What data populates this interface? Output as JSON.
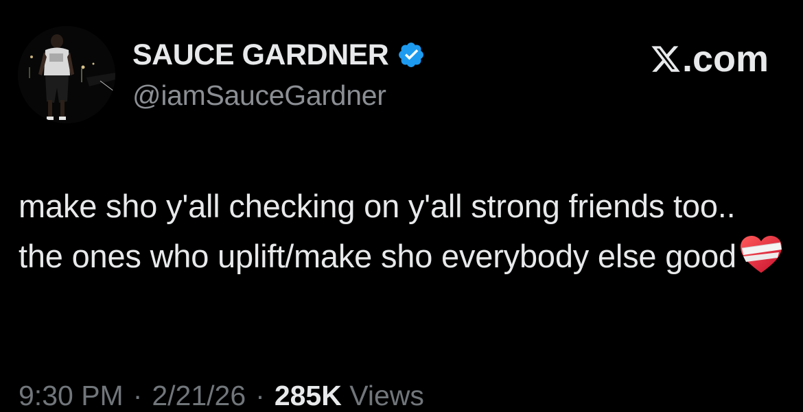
{
  "author": {
    "display_name": "SAUCE GARDNER",
    "handle": "@iamSauceGardner",
    "verified": true,
    "avatar": "avatar-photo-person-standing-night"
  },
  "brand": {
    "text": ".com",
    "icon": "x-logo-icon"
  },
  "tweet": {
    "text": "make sho y'all checking on y'all strong friends too.. the ones who uplift/make sho everybody else good",
    "emoji": "mending-heart-icon"
  },
  "meta": {
    "time": "9:30 PM",
    "date": "2/21/26",
    "separator": "·",
    "views_count": "285K",
    "views_label": "Views"
  },
  "colors": {
    "background": "#000000",
    "primary_text": "#e7e9ea",
    "secondary_text": "#8b8f94",
    "verified_blue": "#1d9bf0"
  }
}
